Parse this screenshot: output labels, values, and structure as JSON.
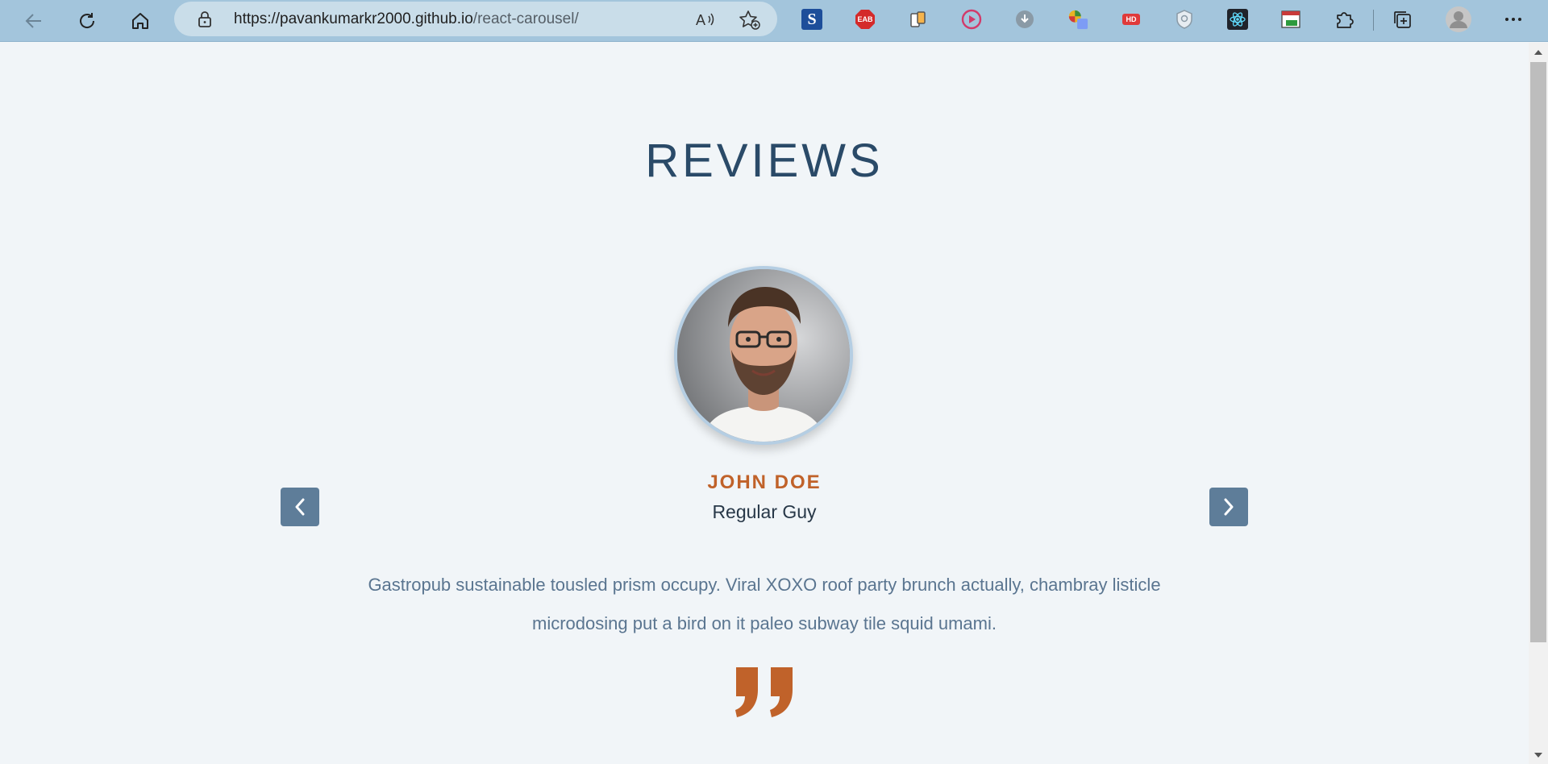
{
  "browser": {
    "url_host": "https://pavankumarkr2000.github.io",
    "url_path": "/react-carousel/",
    "extensions": [
      "s-extension-icon",
      "eab-extension-icon",
      "device-mode-extension-icon",
      "play-extension-icon",
      "download-extension-icon",
      "color-picker-extension-icon",
      "hd-extension-icon",
      "shield-extension-icon",
      "react-devtools-icon",
      "html-validator-icon"
    ],
    "ext_labels": {
      "eab": "EAB",
      "hd": "HD"
    }
  },
  "page": {
    "title": "REVIEWS",
    "review": {
      "name": "JOHN DOE",
      "job": "Regular Guy",
      "text": "Gastropub sustainable tousled prism occupy. Viral XOXO roof party brunch actually, chambray listicle microdosing put a bird on it paleo subway tile squid umami."
    }
  },
  "colors": {
    "toolbar": "#a3c5dc",
    "page_bg": "#f1f5f8",
    "title": "#2a4a68",
    "accent": "#c0622a",
    "button": "#5e7d99",
    "text": "#5a7590"
  }
}
